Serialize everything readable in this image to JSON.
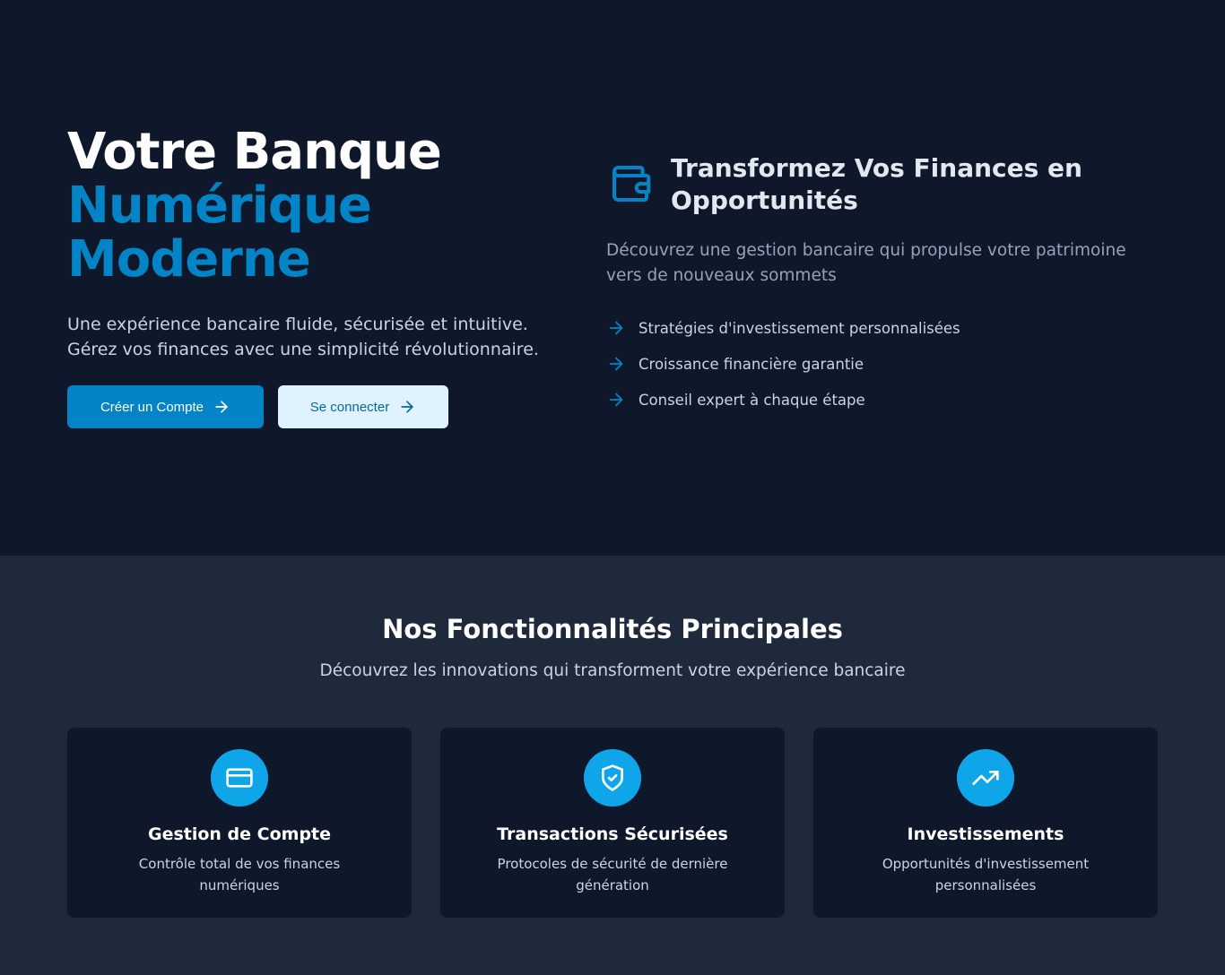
{
  "hero": {
    "title_line1": "Votre Banque",
    "title_line2": "Numérique",
    "title_line3": "Moderne",
    "description": "Une expérience bancaire fluide, sécurisée et intuitive. Gérez vos finances avec une simplicité révolutionnaire.",
    "primary_button": "Créer un Compte",
    "secondary_button": "Se connecter",
    "right": {
      "icon": "wallet-icon",
      "title": "Transformez Vos Finances en Opportunités",
      "description": "Découvrez une gestion bancaire qui propulse votre patrimoine vers de nouveaux sommets",
      "items": [
        "Stratégies d'investissement personnalisées",
        "Croissance financière garantie",
        "Conseil expert à chaque étape"
      ]
    }
  },
  "features": {
    "title": "Nos Fonctionnalités Principales",
    "subtitle": "Découvrez les innovations qui transforment votre expérience bancaire",
    "cards": [
      {
        "icon": "credit-card-icon",
        "title": "Gestion de Compte",
        "description": "Contrôle total de vos finances numériques"
      },
      {
        "icon": "shield-check-icon",
        "title": "Transactions Sécurisées",
        "description": "Protocoles de sécurité de dernière génération"
      },
      {
        "icon": "trending-up-icon",
        "title": "Investissements",
        "description": "Opportunités d'investissement personnalisées"
      }
    ]
  },
  "colors": {
    "hero_bg": "#0f172a",
    "section_bg": "#1e293b",
    "accent": "#0284c7",
    "icon_circle": "#0ea5e9",
    "secondary_button_bg": "#e0f2fe"
  }
}
